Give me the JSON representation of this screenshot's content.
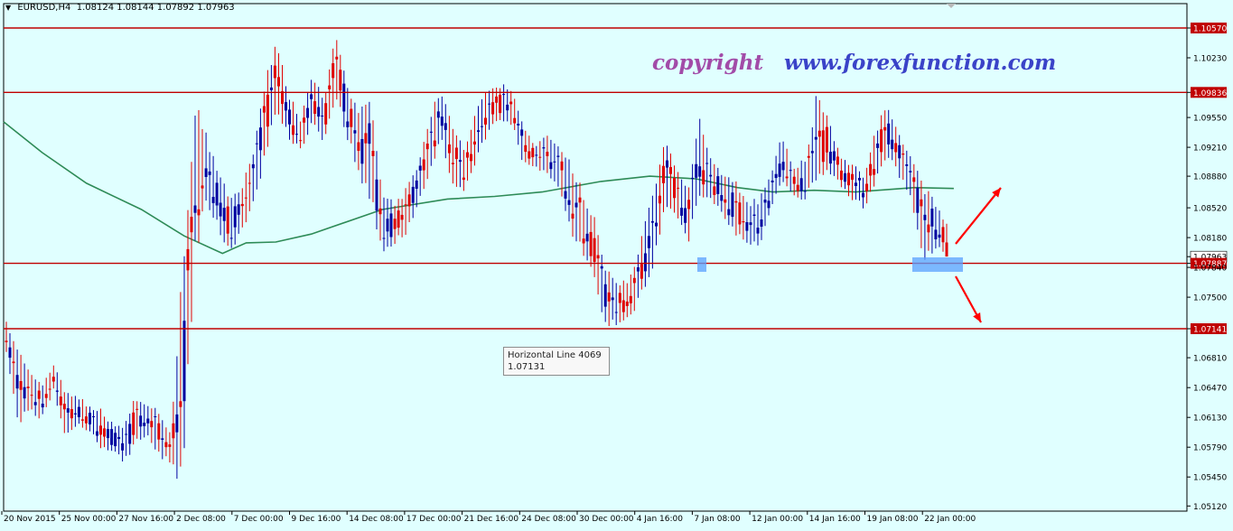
{
  "header": {
    "symbol": "EURUSD,H4",
    "ohlc": "1.08124 1.08144 1.07892 1.07963"
  },
  "watermark": {
    "copyright": "copyright",
    "site": "www.forexfunction.com"
  },
  "tooltip": {
    "title": "Horizontal Line 4069",
    "value": "1.07131"
  },
  "colors": {
    "background": "#e0ffff",
    "bull": "#0000a0",
    "bear": "#e00000",
    "ma": "#2e8b57",
    "hline": "#c00000",
    "highlight": "#5aa0ff",
    "arrow": "#ff0000"
  },
  "chart_data": {
    "type": "candlestick",
    "ylim": [
      1.0502,
      1.0599
    ],
    "y_ticks": [
      "1.10570",
      "1.10230",
      "1.09836",
      "1.09550",
      "1.09210",
      "1.08880",
      "1.08520",
      "1.08180",
      "1.07963",
      "1.07887",
      "1.07840",
      "1.07500",
      "1.07141",
      "1.06810",
      "1.06470",
      "1.06130",
      "1.05790",
      "1.05450",
      "1.05120"
    ],
    "x_labels": [
      "20 Nov 2015",
      "25 Nov 00:00",
      "27 Nov 16:00",
      "2 Dec 08:00",
      "7 Dec 00:00",
      "9 Dec 16:00",
      "14 Dec 08:00",
      "17 Dec 00:00",
      "21 Dec 16:00",
      "24 Dec 08:00",
      "30 Dec 00:00",
      "4 Jan 16:00",
      "7 Jan 08:00",
      "12 Jan 00:00",
      "14 Jan 16:00",
      "19 Jan 08:00",
      "22 Jan 00:00"
    ],
    "horizontal_lines": [
      {
        "value": 1.1057,
        "label": "1.10570"
      },
      {
        "value": 1.09836,
        "label": "1.09836"
      },
      {
        "value": 1.07887,
        "label": "1.07887"
      },
      {
        "value": 1.07141,
        "label": "1.07141"
      }
    ],
    "current_price": {
      "value": 1.07963,
      "label": "1.07963"
    },
    "anchors": [
      {
        "h": 1.0722,
        "l": 1.0682
      },
      {
        "h": 1.07,
        "l": 1.0604
      },
      {
        "h": 1.0672,
        "l": 1.0616
      },
      {
        "h": 1.0652,
        "l": 1.0608
      },
      {
        "h": 1.0676,
        "l": 1.0642
      },
      {
        "h": 1.0648,
        "l": 1.0588
      },
      {
        "h": 1.064,
        "l": 1.0602
      },
      {
        "h": 1.0628,
        "l": 1.0596
      },
      {
        "h": 1.0624,
        "l": 1.0578
      },
      {
        "h": 1.0608,
        "l": 1.0572
      },
      {
        "h": 1.0602,
        "l": 1.056
      },
      {
        "h": 1.064,
        "l": 1.058
      },
      {
        "h": 1.0632,
        "l": 1.059
      },
      {
        "h": 1.0622,
        "l": 1.0566
      },
      {
        "h": 1.0596,
        "l": 1.056
      },
      {
        "h": 1.0798,
        "l": 1.0526
      },
      {
        "h": 1.098,
        "l": 1.0785
      },
      {
        "h": 1.094,
        "l": 1.0852
      },
      {
        "h": 1.09,
        "l": 1.0825
      },
      {
        "h": 1.0865,
        "l": 1.08
      },
      {
        "h": 1.088,
        "l": 1.082
      },
      {
        "h": 1.092,
        "l": 1.085
      },
      {
        "h": 1.1,
        "l": 1.0905
      },
      {
        "h": 1.105,
        "l": 1.096
      },
      {
        "h": 1.0985,
        "l": 1.093
      },
      {
        "h": 1.0955,
        "l": 1.0915
      },
      {
        "h": 1.101,
        "l": 1.0945
      },
      {
        "h": 1.0975,
        "l": 1.0925
      },
      {
        "h": 1.106,
        "l": 1.0975
      },
      {
        "h": 1.1,
        "l": 1.093
      },
      {
        "h": 1.096,
        "l": 1.089
      },
      {
        "h": 1.099,
        "l": 1.085
      },
      {
        "h": 1.087,
        "l": 1.08
      },
      {
        "h": 1.086,
        "l": 1.081
      },
      {
        "h": 1.0875,
        "l": 1.082
      },
      {
        "h": 1.0905,
        "l": 1.085
      },
      {
        "h": 1.096,
        "l": 1.089
      },
      {
        "h": 1.099,
        "l": 1.0925
      },
      {
        "h": 1.095,
        "l": 1.087
      },
      {
        "h": 1.092,
        "l": 1.087
      },
      {
        "h": 1.0965,
        "l": 1.0905
      },
      {
        "h": 1.099,
        "l": 1.0935
      },
      {
        "h": 1.0995,
        "l": 1.095
      },
      {
        "h": 1.099,
        "l": 1.0945
      },
      {
        "h": 1.095,
        "l": 1.09
      },
      {
        "h": 1.0925,
        "l": 1.0895
      },
      {
        "h": 1.0935,
        "l": 1.089
      },
      {
        "h": 1.0925,
        "l": 1.087
      },
      {
        "h": 1.0905,
        "l": 1.082
      },
      {
        "h": 1.0875,
        "l": 1.08
      },
      {
        "h": 1.0845,
        "l": 1.0768
      },
      {
        "h": 1.0785,
        "l": 1.0712
      },
      {
        "h": 1.077,
        "l": 1.0718
      },
      {
        "h": 1.077,
        "l": 1.0722
      },
      {
        "h": 1.082,
        "l": 1.075
      },
      {
        "h": 1.087,
        "l": 1.078
      },
      {
        "h": 1.0935,
        "l": 1.084
      },
      {
        "h": 1.09,
        "l": 1.084
      },
      {
        "h": 1.088,
        "l": 1.081
      },
      {
        "h": 1.0955,
        "l": 1.086
      },
      {
        "h": 1.0905,
        "l": 1.086
      },
      {
        "h": 1.0895,
        "l": 1.084
      },
      {
        "h": 1.0885,
        "l": 1.082
      },
      {
        "h": 1.086,
        "l": 1.0812
      },
      {
        "h": 1.0865,
        "l": 1.0802
      },
      {
        "h": 1.0895,
        "l": 1.0845
      },
      {
        "h": 1.0935,
        "l": 1.088
      },
      {
        "h": 1.09,
        "l": 1.0862
      },
      {
        "h": 1.091,
        "l": 1.086
      },
      {
        "h": 1.099,
        "l": 1.088
      },
      {
        "h": 1.095,
        "l": 1.089
      },
      {
        "h": 1.091,
        "l": 1.0875
      },
      {
        "h": 1.0905,
        "l": 1.086
      },
      {
        "h": 1.089,
        "l": 1.085
      },
      {
        "h": 1.0945,
        "l": 1.088
      },
      {
        "h": 1.0975,
        "l": 1.091
      },
      {
        "h": 1.0935,
        "l": 1.0885
      },
      {
        "h": 1.0915,
        "l": 1.086
      },
      {
        "h": 1.088,
        "l": 1.079
      },
      {
        "h": 1.086,
        "l": 1.08
      },
      {
        "h": 1.0835,
        "l": 1.08
      }
    ],
    "moving_average": [
      [
        0,
        1.095
      ],
      [
        0.0325,
        1.0915
      ],
      [
        0.07,
        1.088
      ],
      [
        0.1165,
        1.085
      ],
      [
        0.1525,
        1.082
      ],
      [
        0.185,
        1.08
      ],
      [
        0.205,
        1.0812
      ],
      [
        0.23,
        1.0813
      ],
      [
        0.26,
        1.0822
      ],
      [
        0.32,
        1.085
      ],
      [
        0.375,
        1.0862
      ],
      [
        0.415,
        1.0865
      ],
      [
        0.455,
        1.087
      ],
      [
        0.505,
        1.0882
      ],
      [
        0.546,
        1.0888
      ],
      [
        0.585,
        1.0885
      ],
      [
        0.62,
        1.0875
      ],
      [
        0.65,
        1.087
      ],
      [
        0.685,
        1.0872
      ],
      [
        0.72,
        1.087
      ],
      [
        0.77,
        1.0875
      ],
      [
        0.803,
        1.0874
      ]
    ]
  }
}
